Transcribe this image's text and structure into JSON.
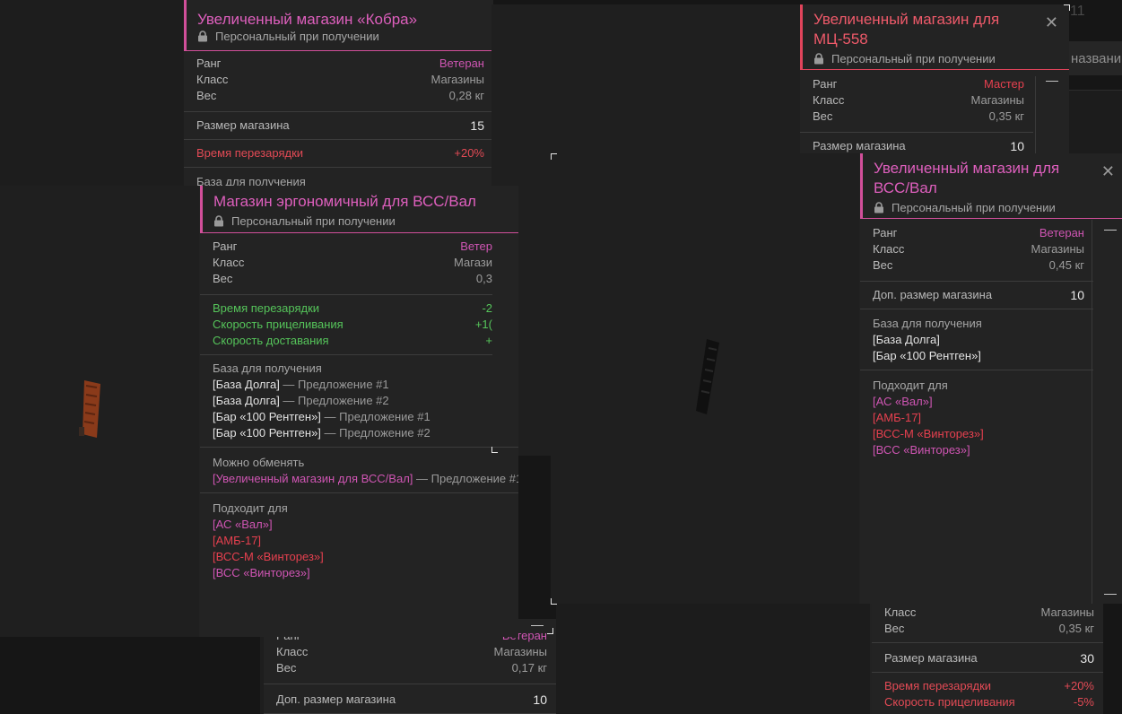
{
  "background_text": {
    "top_number": "11",
    "search_hint": "названи"
  },
  "card_bottom_middle": {
    "rank_label": "Ранг",
    "rank_value": "Ветеран",
    "class_label": "Класс",
    "class_value": "Магазины",
    "weight_label": "Вес",
    "weight_value": "0,17 кг",
    "extra_size_label": "Доп. размер магазина",
    "extra_size_value": "10"
  },
  "card_bottom_right": {
    "class_label": "Класс",
    "class_value": "Магазины",
    "weight_label": "Вес",
    "weight_value": "0,35 кг",
    "size_label": "Размер магазина",
    "size_value": "30",
    "reload_label": "Время перезарядки",
    "reload_value": "+20%",
    "aim_label": "Скорость прицеливания",
    "aim_value": "-5%"
  },
  "card_kobra": {
    "title": "Увеличенный магазин «Кобра»",
    "personal": "Персональный при получении",
    "rank_label": "Ранг",
    "rank_value": "Ветеран",
    "class_label": "Класс",
    "class_value": "Магазины",
    "weight_label": "Вес",
    "weight_value": "0,28 кг",
    "size_label": "Размер магазина",
    "size_value": "15",
    "reload_label": "Время перезарядки",
    "reload_value": "+20%",
    "base_label": "База для получения"
  },
  "card_mc558": {
    "title_line1": "Увеличенный магазин для",
    "title_line2": "МЦ-558",
    "personal": "Персональный при получении",
    "rank_label": "Ранг",
    "rank_value": "Мастер",
    "class_label": "Класс",
    "class_value": "Магазины",
    "weight_label": "Вес",
    "weight_value": "0,35 кг",
    "size_label": "Размер магазина",
    "size_value": "10"
  },
  "card_ergo": {
    "title": "Магазин эргономичный для ВСС/Вал",
    "personal": "Персональный при получении",
    "rank_label": "Ранг",
    "rank_value": "Ветер",
    "class_label": "Класс",
    "class_value": "Магази",
    "weight_label": "Вес",
    "weight_value": "0,3",
    "stats": [
      {
        "label": "Время перезарядки",
        "value": "-2"
      },
      {
        "label": "Скорость прицеливания",
        "value": "+1("
      },
      {
        "label": "Скорость доставания",
        "value": "+"
      }
    ],
    "base_label": "База для получения",
    "bases": [
      {
        "name": "[База Долга]",
        "offer": " — Предложение #1"
      },
      {
        "name": "[База Долга]",
        "offer": " — Предложение #2"
      },
      {
        "name": "[Бар «100 Рентген»]",
        "offer": " — Предложение #1"
      },
      {
        "name": "[Бар «100 Рентген»]",
        "offer": " — Предложение #2"
      }
    ],
    "exchange_label": "Можно обменять",
    "exchange_item": "[Увеличенный магазин для ВСС/Вал]",
    "exchange_offer": " — Предложение #1",
    "fits_label": "Подходит для",
    "fits": [
      {
        "name": "[АС «Вал»]",
        "color": "p"
      },
      {
        "name": "[АМБ-17]",
        "color": "r"
      },
      {
        "name": "[ВСС-М «Винторез»]",
        "color": "r"
      },
      {
        "name": "[ВСС «Винторез»]",
        "color": "p"
      }
    ]
  },
  "card_vss": {
    "title_line1": "Увеличенный магазин для",
    "title_line2": "ВСС/Вал",
    "personal": "Персональный при получении",
    "rank_label": "Ранг",
    "rank_value": "Ветеран",
    "class_label": "Класс",
    "class_value": "Магазины",
    "weight_label": "Вес",
    "weight_value": "0,45 кг",
    "extra_size_label": "Доп. размер магазина",
    "extra_size_value": "10",
    "base_label": "База для получения",
    "bases": [
      "[База Долга]",
      "[Бар «100 Рентген»]"
    ],
    "fits_label": "Подходит для",
    "fits": [
      {
        "name": "[АС «Вал»]",
        "color": "p"
      },
      {
        "name": "[АМБ-17]",
        "color": "r"
      },
      {
        "name": "[ВСС-М «Винторез»]",
        "color": "r"
      },
      {
        "name": "[ВСС «Винторез»]",
        "color": "p"
      }
    ]
  },
  "colors": {
    "veteran": "#cf55b3",
    "master": "#e6404f",
    "positive": "#55c45a",
    "negative": "#e24a55",
    "accent_pink": "#d14f9a"
  },
  "icons": [
    "lock-icon",
    "close-icon",
    "minimize-icon",
    "magazine-icon"
  ]
}
